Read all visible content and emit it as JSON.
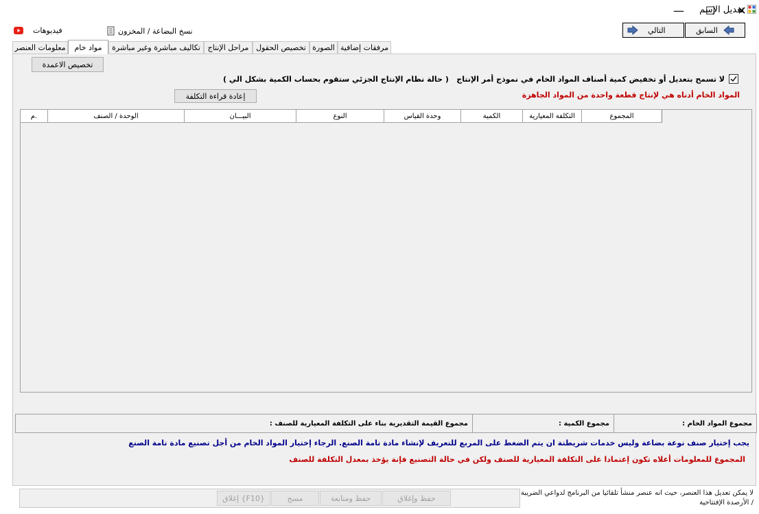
{
  "window": {
    "title": "تعديل الإسم",
    "minimize": "—",
    "maximize": "☐",
    "close": "✕"
  },
  "nav": {
    "prev_label": "السابق",
    "next_label": "التالي",
    "copy_item_label": "نسخ البضاعة / المخزون",
    "videos_label": "فيديوهات"
  },
  "tabs": [
    {
      "label": "معلومات العنصر",
      "active": false
    },
    {
      "label": "مواد خام",
      "active": true
    },
    {
      "label": "تكاليف مباشرة وغير مباشرة",
      "active": false
    },
    {
      "label": "مراحل الإنتاج",
      "active": false
    },
    {
      "label": "تخصيص الحقول",
      "active": false
    },
    {
      "label": "الصورة",
      "active": false
    },
    {
      "label": "مرفقات إضافية",
      "active": false
    }
  ],
  "raw": {
    "customize_columns_label": "تخصيص الاعمدة",
    "checkbox_label": "لا تسمح بتعديل أو تخفيض كمية أصناف المواد الخام في نموذج أمر الإنتاج",
    "checkbox_checked": true,
    "partial_note": "( حالة نظام الإنتاج الجزئي ستقوم بحساب الكمية بشكل الي )",
    "recalc_label": "إعادة قراءة التكلفة",
    "red_note": "المواد الخام أدناه هي لإنتاج قطعة واحدة من المواد الجاهزة"
  },
  "grid": {
    "columns": [
      "م.",
      "الوحدة / الصنف",
      "البيـــان",
      "النوع",
      "وحدة القياس",
      "الكمية",
      "التكلفة المعيارية",
      "المجموع"
    ]
  },
  "summary": {
    "raw_total_label": "مجموع المواد الخام :",
    "qty_total_label": "مجموع الكمية :",
    "estimated_value_label": "مجموع القيمة التقديرية بناء على التكلفة المعيارية للصنف :"
  },
  "messages": {
    "blue": "يجب إختيار صنف نوعة بضاعة وليس خدمات شريطتة ان يتم الضغط على المربع للتعريف لإنشاء مادة تامة الصنع. الرجاء إختيار المواد الخام من أجل تصنيع مادة تامة الصنع",
    "red": "المجموع للمعلومات أعلاه تكون إعتمادا على التكلفة المعيارية للصنف ولكن في حالة التصنيع فإنة يؤخذ بمعدل التكلفة للصنف"
  },
  "footer": {
    "note": "لا يمكن تعديل هذا العنصر، حيث انه عنصر منشأ تلقائيا من البرنامج لدواعي الضريبة / الأرصدة الإفتتاحية",
    "save_close": "حفظ وإغلاق",
    "save_continue": "حفظ ومتابعة",
    "clear": "مسح",
    "close": "إغلاق {F10}"
  },
  "colors": {
    "accent_blue": "#00008b",
    "alert_red": "#c00000",
    "youtube_red": "#e62117"
  }
}
